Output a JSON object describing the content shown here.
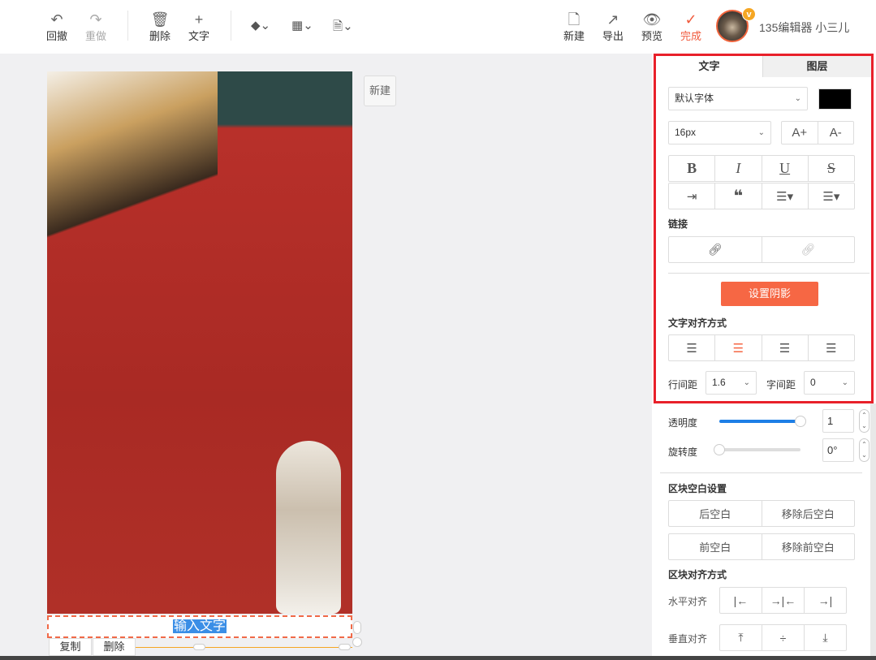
{
  "toolbar": {
    "undo": "回撤",
    "redo": "重做",
    "delete": "删除",
    "text": "文字",
    "new": "新建",
    "export": "导出",
    "preview": "预览",
    "done": "完成",
    "username": "135编辑器 小三儿",
    "badge": "v"
  },
  "canvas": {
    "new_button": "新建",
    "text_placeholder": "输入文字",
    "copy": "复制",
    "delete": "删除"
  },
  "panel": {
    "tabs": [
      "文字",
      "图层"
    ],
    "font_family": "默认字体",
    "font_color": "#000000",
    "font_size": "16px",
    "increase": "A+",
    "decrease": "A-",
    "format": {
      "bold": "B",
      "italic": "I",
      "underline": "U",
      "strike": "S"
    },
    "link_label": "链接",
    "shadow_button": "设置阴影",
    "text_align_label": "文字对齐方式",
    "line_height_label": "行间距",
    "line_height": "1.6",
    "letter_spacing_label": "字间距",
    "letter_spacing": "0",
    "opacity_label": "透明度",
    "opacity": "1",
    "opacity_fraction": 1,
    "rotation_label": "旋转度",
    "rotation": "0°",
    "rotation_fraction": 0,
    "spacing_label": "区块空白设置",
    "after_space": "后空白",
    "remove_after": "移除后空白",
    "before_space": "前空白",
    "remove_before": "移除前空白",
    "block_align_label": "区块对齐方式",
    "horizontal_label": "水平对齐",
    "vertical_label": "垂直对齐"
  },
  "colors": {
    "accent": "#f66744",
    "highlight": "#e8202a",
    "slider": "#1e7fe6"
  }
}
